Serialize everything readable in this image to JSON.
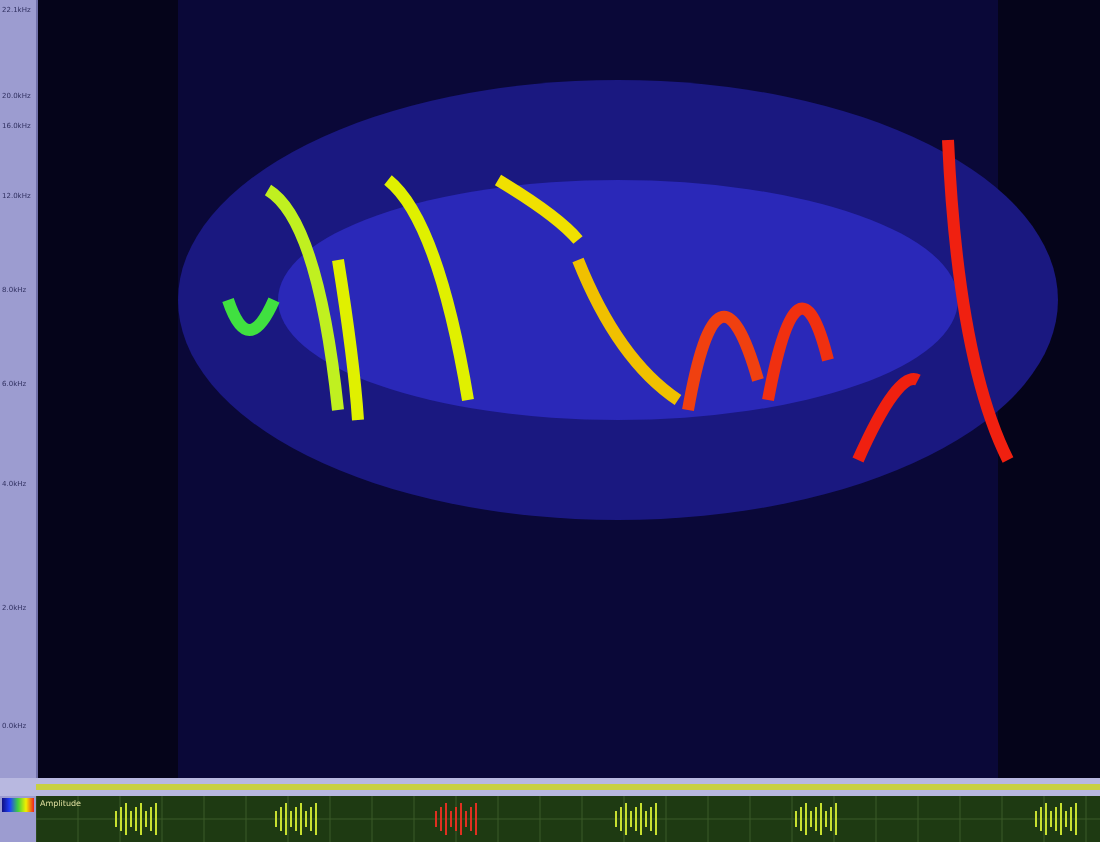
{
  "frequency_axis": {
    "labels": [
      "22.1kHz",
      "20.0kHz",
      "16.0kHz",
      "12.0kHz",
      "8.0kHz",
      "6.0kHz",
      "4.0kHz",
      "2.0kHz",
      "0.0kHz"
    ]
  },
  "waveform": {
    "title": "Amplitude"
  }
}
